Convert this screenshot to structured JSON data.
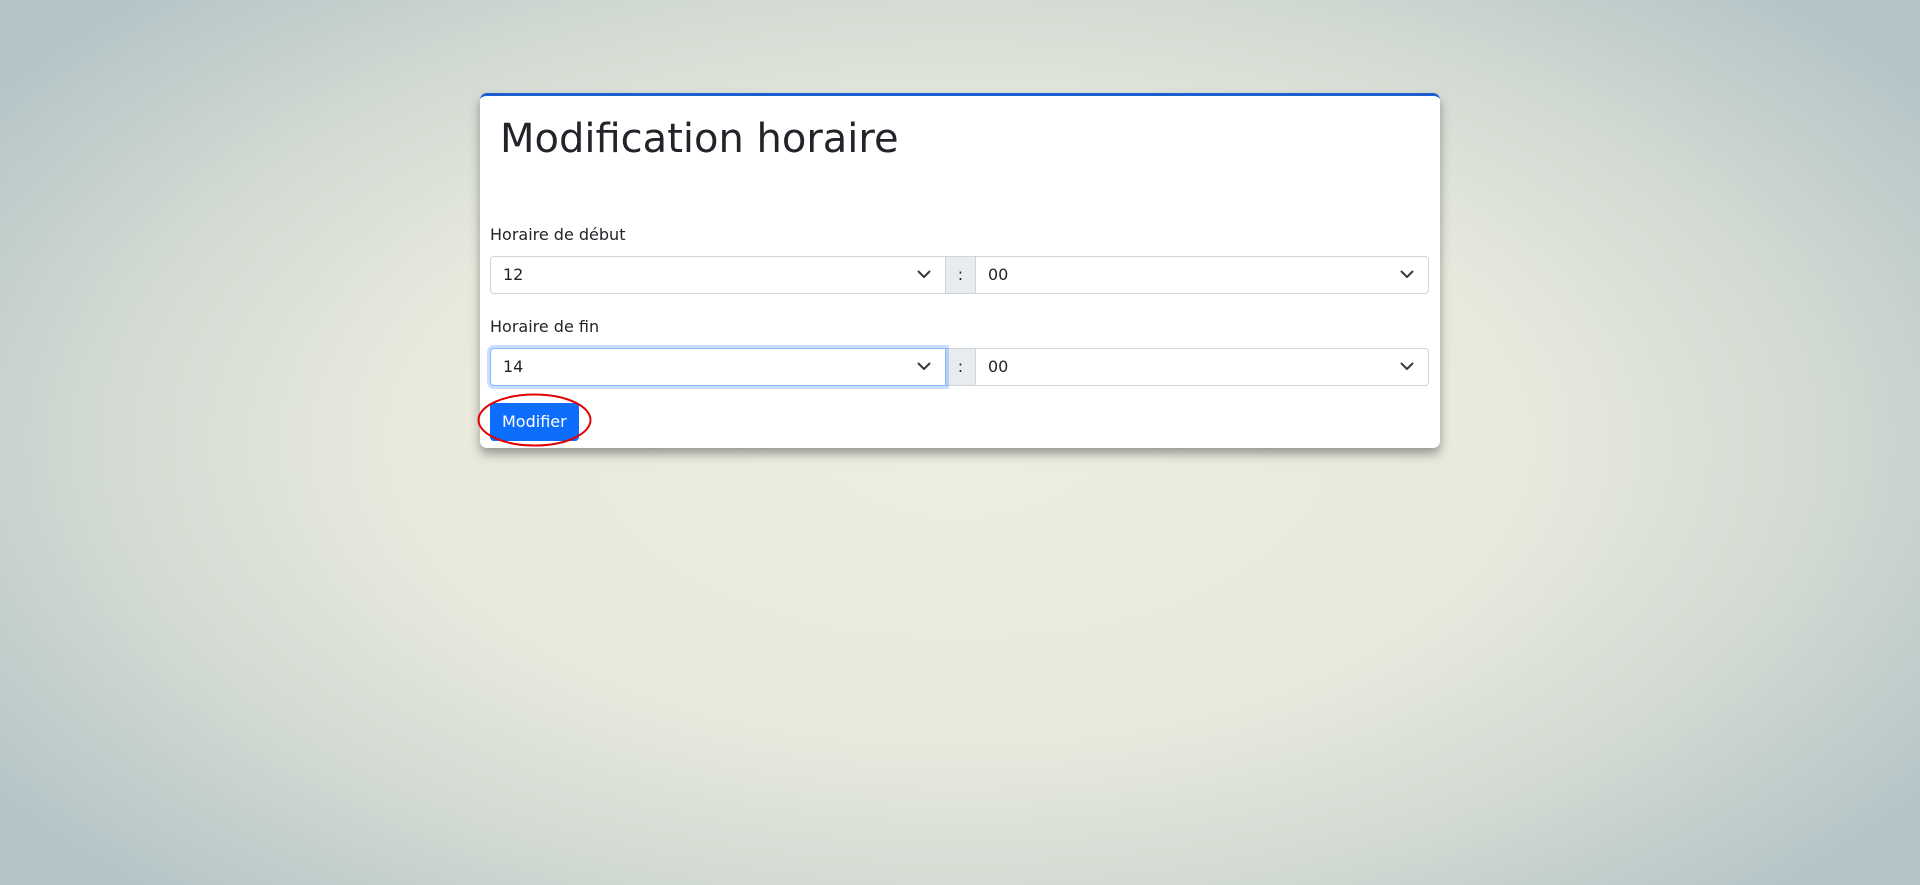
{
  "page": {
    "title": "Modification horaire"
  },
  "form": {
    "start": {
      "label": "Horaire de début",
      "hour": "12",
      "separator": ":",
      "minute": "00"
    },
    "end": {
      "label": "Horaire de fin",
      "hour": "14",
      "separator": ":",
      "minute": "00"
    },
    "submit_label": "Modifier"
  },
  "icons": {
    "dropdown": "chevron-down-icon"
  },
  "colors": {
    "primary": "#0d6efd",
    "card_top_border": "#1b5fd0",
    "annotation": "#e00000"
  },
  "annotation": {
    "shape": "ellipse",
    "target": "submit-button"
  }
}
